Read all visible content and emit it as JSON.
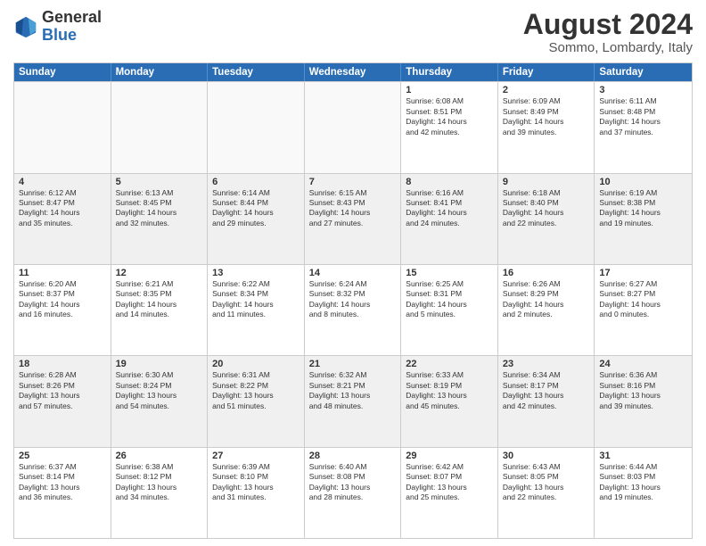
{
  "header": {
    "logo": {
      "general": "General",
      "blue": "Blue"
    },
    "title": "August 2024",
    "subtitle": "Sommo, Lombardy, Italy"
  },
  "calendar": {
    "days_of_week": [
      "Sunday",
      "Monday",
      "Tuesday",
      "Wednesday",
      "Thursday",
      "Friday",
      "Saturday"
    ],
    "weeks": [
      [
        {
          "day": "",
          "info": "",
          "empty": true
        },
        {
          "day": "",
          "info": "",
          "empty": true
        },
        {
          "day": "",
          "info": "",
          "empty": true
        },
        {
          "day": "",
          "info": "",
          "empty": true
        },
        {
          "day": "1",
          "info": "Sunrise: 6:08 AM\nSunset: 8:51 PM\nDaylight: 14 hours\nand 42 minutes."
        },
        {
          "day": "2",
          "info": "Sunrise: 6:09 AM\nSunset: 8:49 PM\nDaylight: 14 hours\nand 39 minutes."
        },
        {
          "day": "3",
          "info": "Sunrise: 6:11 AM\nSunset: 8:48 PM\nDaylight: 14 hours\nand 37 minutes."
        }
      ],
      [
        {
          "day": "4",
          "info": "Sunrise: 6:12 AM\nSunset: 8:47 PM\nDaylight: 14 hours\nand 35 minutes."
        },
        {
          "day": "5",
          "info": "Sunrise: 6:13 AM\nSunset: 8:45 PM\nDaylight: 14 hours\nand 32 minutes."
        },
        {
          "day": "6",
          "info": "Sunrise: 6:14 AM\nSunset: 8:44 PM\nDaylight: 14 hours\nand 29 minutes."
        },
        {
          "day": "7",
          "info": "Sunrise: 6:15 AM\nSunset: 8:43 PM\nDaylight: 14 hours\nand 27 minutes."
        },
        {
          "day": "8",
          "info": "Sunrise: 6:16 AM\nSunset: 8:41 PM\nDaylight: 14 hours\nand 24 minutes."
        },
        {
          "day": "9",
          "info": "Sunrise: 6:18 AM\nSunset: 8:40 PM\nDaylight: 14 hours\nand 22 minutes."
        },
        {
          "day": "10",
          "info": "Sunrise: 6:19 AM\nSunset: 8:38 PM\nDaylight: 14 hours\nand 19 minutes."
        }
      ],
      [
        {
          "day": "11",
          "info": "Sunrise: 6:20 AM\nSunset: 8:37 PM\nDaylight: 14 hours\nand 16 minutes."
        },
        {
          "day": "12",
          "info": "Sunrise: 6:21 AM\nSunset: 8:35 PM\nDaylight: 14 hours\nand 14 minutes."
        },
        {
          "day": "13",
          "info": "Sunrise: 6:22 AM\nSunset: 8:34 PM\nDaylight: 14 hours\nand 11 minutes."
        },
        {
          "day": "14",
          "info": "Sunrise: 6:24 AM\nSunset: 8:32 PM\nDaylight: 14 hours\nand 8 minutes."
        },
        {
          "day": "15",
          "info": "Sunrise: 6:25 AM\nSunset: 8:31 PM\nDaylight: 14 hours\nand 5 minutes."
        },
        {
          "day": "16",
          "info": "Sunrise: 6:26 AM\nSunset: 8:29 PM\nDaylight: 14 hours\nand 2 minutes."
        },
        {
          "day": "17",
          "info": "Sunrise: 6:27 AM\nSunset: 8:27 PM\nDaylight: 14 hours\nand 0 minutes."
        }
      ],
      [
        {
          "day": "18",
          "info": "Sunrise: 6:28 AM\nSunset: 8:26 PM\nDaylight: 13 hours\nand 57 minutes."
        },
        {
          "day": "19",
          "info": "Sunrise: 6:30 AM\nSunset: 8:24 PM\nDaylight: 13 hours\nand 54 minutes."
        },
        {
          "day": "20",
          "info": "Sunrise: 6:31 AM\nSunset: 8:22 PM\nDaylight: 13 hours\nand 51 minutes."
        },
        {
          "day": "21",
          "info": "Sunrise: 6:32 AM\nSunset: 8:21 PM\nDaylight: 13 hours\nand 48 minutes."
        },
        {
          "day": "22",
          "info": "Sunrise: 6:33 AM\nSunset: 8:19 PM\nDaylight: 13 hours\nand 45 minutes."
        },
        {
          "day": "23",
          "info": "Sunrise: 6:34 AM\nSunset: 8:17 PM\nDaylight: 13 hours\nand 42 minutes."
        },
        {
          "day": "24",
          "info": "Sunrise: 6:36 AM\nSunset: 8:16 PM\nDaylight: 13 hours\nand 39 minutes."
        }
      ],
      [
        {
          "day": "25",
          "info": "Sunrise: 6:37 AM\nSunset: 8:14 PM\nDaylight: 13 hours\nand 36 minutes."
        },
        {
          "day": "26",
          "info": "Sunrise: 6:38 AM\nSunset: 8:12 PM\nDaylight: 13 hours\nand 34 minutes."
        },
        {
          "day": "27",
          "info": "Sunrise: 6:39 AM\nSunset: 8:10 PM\nDaylight: 13 hours\nand 31 minutes."
        },
        {
          "day": "28",
          "info": "Sunrise: 6:40 AM\nSunset: 8:08 PM\nDaylight: 13 hours\nand 28 minutes."
        },
        {
          "day": "29",
          "info": "Sunrise: 6:42 AM\nSunset: 8:07 PM\nDaylight: 13 hours\nand 25 minutes."
        },
        {
          "day": "30",
          "info": "Sunrise: 6:43 AM\nSunset: 8:05 PM\nDaylight: 13 hours\nand 22 minutes."
        },
        {
          "day": "31",
          "info": "Sunrise: 6:44 AM\nSunset: 8:03 PM\nDaylight: 13 hours\nand 19 minutes."
        }
      ]
    ]
  }
}
